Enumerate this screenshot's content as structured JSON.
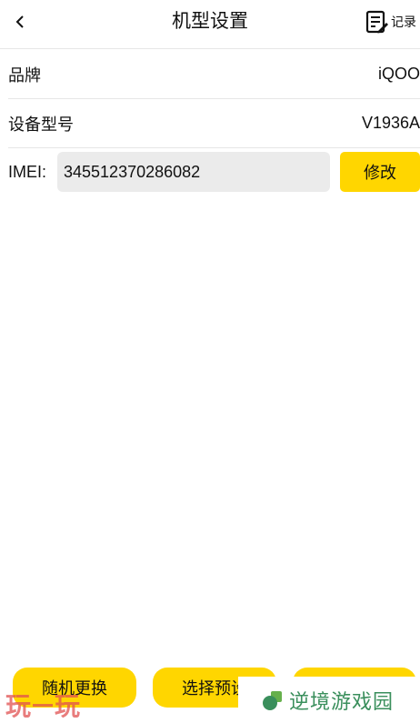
{
  "header": {
    "title": "机型设置",
    "record_label": "记录"
  },
  "rows": {
    "brand": {
      "label": "品牌",
      "value": "iQOO"
    },
    "model": {
      "label": "设备型号",
      "value": "V1936A"
    }
  },
  "imei": {
    "label": "IMEI:",
    "value": "345512370286082",
    "modify_label": "修改"
  },
  "bottom": {
    "random_label": "随机更换",
    "preset_label": "选择预设"
  },
  "watermark": {
    "left_text_1": "玩",
    "left_text_2": "玩",
    "right_text": "逆境游戏园"
  },
  "colors": {
    "accent": "#ffd600",
    "input_bg": "#ebebeb",
    "watermark_green": "#3a8f5c"
  }
}
